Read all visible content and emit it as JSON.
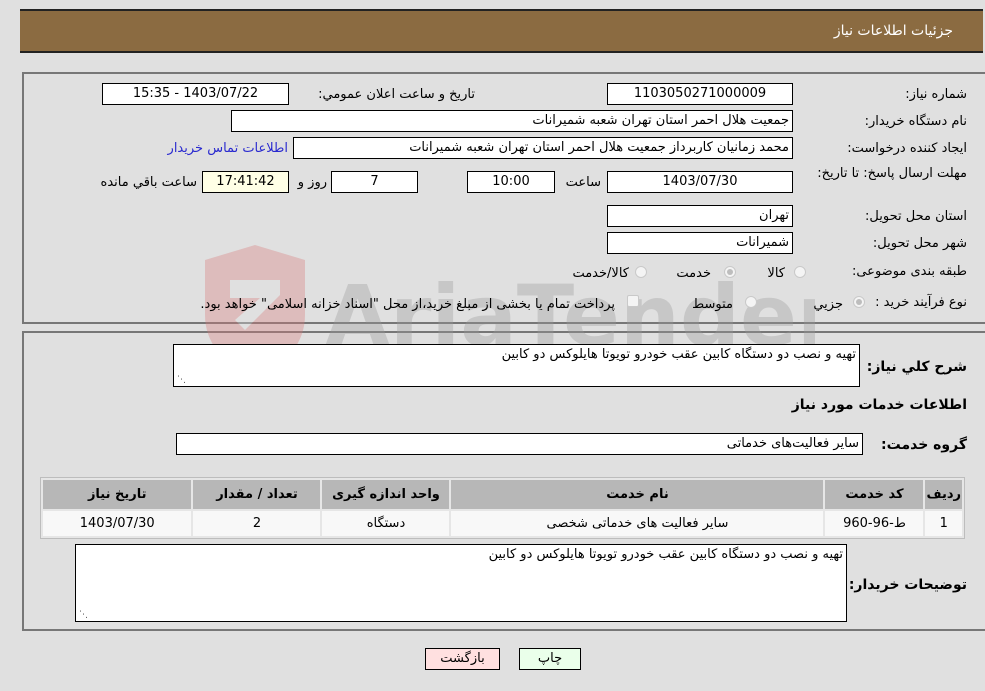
{
  "header": {
    "title": "جزئیات اطلاعات نیاز"
  },
  "details": {
    "need_number": {
      "label": "شماره نیاز:",
      "value": "1103050271000009"
    },
    "announce_datetime": {
      "label": "تاریخ و ساعت اعلان عمومي:",
      "value": "1403/07/22 - 15:35"
    },
    "buyer_org": {
      "label": "نام دستگاه خریدار:",
      "value": "جمعیت هلال احمر استان تهران شعبه شمیرانات"
    },
    "requester": {
      "label": "ایجاد کننده درخواست:",
      "value": "محمد زمانیان کاربرداز جمعیت هلال احمر استان تهران شعبه شمیرانات",
      "contact_link": "اطلاعات تماس خریدار"
    },
    "deadline": {
      "label": "مهلت ارسال پاسخ: تا تاریخ:",
      "date": "1403/07/30",
      "time_label": "ساعت",
      "time": "10:00",
      "days": "7",
      "days_label": "روز و",
      "remaining": "17:41:42",
      "remaining_label": "ساعت باقي مانده"
    },
    "province": {
      "label": "استان محل تحویل:",
      "value": "تهران"
    },
    "city": {
      "label": "شهر محل تحویل:",
      "value": "شمیرانات"
    },
    "category": {
      "label": "طبقه بندی موضوعی:",
      "options": [
        "کالا",
        "خدمت",
        "کالا/خدمت"
      ],
      "selected": "خدمت"
    },
    "purchase_type": {
      "label": "نوع فرآیند خرید :",
      "options": [
        "جزيي",
        "متوسط"
      ],
      "selected": "جزيي",
      "treasury_note": "پرداخت تمام یا بخشی از مبلغ خرید،از محل \"اسناد خزانه اسلامی\" خواهد بود."
    }
  },
  "summary": {
    "label": "شرح كلي نياز:",
    "value": "تهیه و نصب دو دستگاه کابین عقب خودرو تویوتا هایلوکس دو کابین"
  },
  "services_section": {
    "title": "اطلاعات خدمات مورد نیاز"
  },
  "service_group": {
    "label": "گروه خدمت:",
    "value": "سایر فعالیت‌های خدماتی"
  },
  "table": {
    "headers": [
      "ردیف",
      "کد خدمت",
      "نام خدمت",
      "واحد اندازه گیری",
      "تعداد / مقدار",
      "تاریخ نیاز"
    ],
    "rows": [
      [
        "1",
        "ط-96-960",
        "سایر فعالیت های خدماتی شخصی",
        "دستگاه",
        "2",
        "1403/07/30"
      ]
    ]
  },
  "buyer_notes": {
    "label": "توضیحات خریدار:",
    "value": "تهیه و نصب دو دستگاه کابین عقب خودرو تویوتا هایلوکس دو کابین"
  },
  "buttons": {
    "print": "چاپ",
    "back": "بازگشت"
  },
  "watermark": {
    "text": "AriaTender.neT"
  },
  "colors": {
    "header_bg": "#8b6b41",
    "link": "#2a2acf",
    "print_bg": "#eaffea",
    "back_bg": "#ffe0e0"
  }
}
